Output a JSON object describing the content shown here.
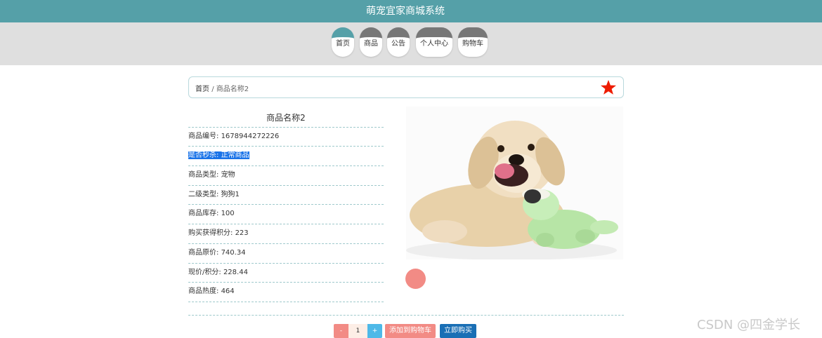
{
  "header": {
    "title": "萌宠宜家商城系统"
  },
  "nav": {
    "items": [
      {
        "label": "首页"
      },
      {
        "label": "商品"
      },
      {
        "label": "公告"
      },
      {
        "label": "个人中心"
      },
      {
        "label": "购物车"
      }
    ]
  },
  "breadcrumb": {
    "home": "首页",
    "separator": "/",
    "current": "商品名称2"
  },
  "product": {
    "title": "商品名称2",
    "fields": [
      {
        "label": "商品编号:",
        "value": "1678944272226"
      },
      {
        "label": "是否秒杀:",
        "value": "正常商品"
      },
      {
        "label": "商品类型:",
        "value": "宠物"
      },
      {
        "label": "二级类型:",
        "value": "狗狗1"
      },
      {
        "label": "商品库存:",
        "value": "100"
      },
      {
        "label": "购买获得积分:",
        "value": "223"
      },
      {
        "label": "商品原价:",
        "value": "740.34"
      },
      {
        "label": "现价/积分:",
        "value": "228.44"
      },
      {
        "label": "商品热度:",
        "value": "464"
      }
    ]
  },
  "actions": {
    "minus": "-",
    "quantity": "1",
    "plus": "+",
    "add_to_cart": "添加到购物车",
    "buy_now": "立即购买"
  },
  "watermark": "CSDN @四金学长",
  "colors": {
    "header": "#55a0a8",
    "nav_active": "#55a0a8",
    "nav_inactive": "#777777",
    "star": "#ee1c00"
  },
  "icons": {
    "favorite": "star-icon"
  }
}
